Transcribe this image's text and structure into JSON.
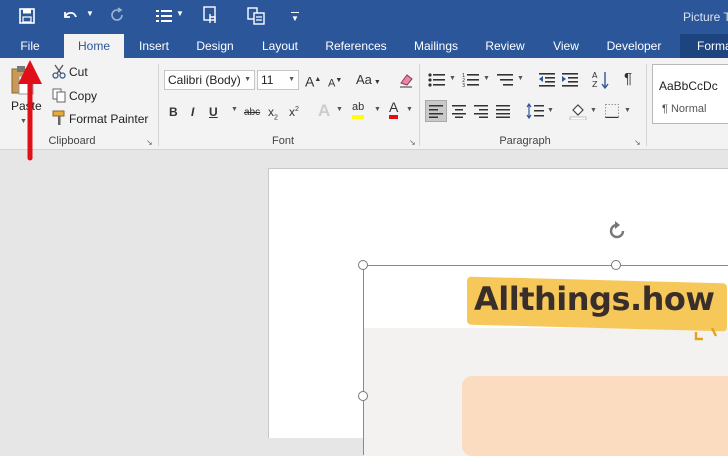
{
  "window": {
    "title_partial": "Picture T"
  },
  "tabs": [
    "File",
    "Home",
    "Insert",
    "Design",
    "Layout",
    "References",
    "Mailings",
    "Review",
    "View",
    "Developer",
    "Forma"
  ],
  "clipboard": {
    "paste": "Paste",
    "cut": "Cut",
    "copy": "Copy",
    "format_painter": "Format Painter",
    "group": "Clipboard"
  },
  "font": {
    "name": "Calibri (Body)",
    "size": "11",
    "group": "Font"
  },
  "paragraph": {
    "group": "Paragraph"
  },
  "styles": {
    "preview": "AaBbCcDc",
    "normal": "¶ Normal"
  },
  "image": {
    "text": "Allthings.how"
  },
  "colors": {
    "brand": "#2b579a",
    "ribbon": "#f3f3f3",
    "arrow": "#e0101a",
    "highlight": "#f6c85a"
  }
}
